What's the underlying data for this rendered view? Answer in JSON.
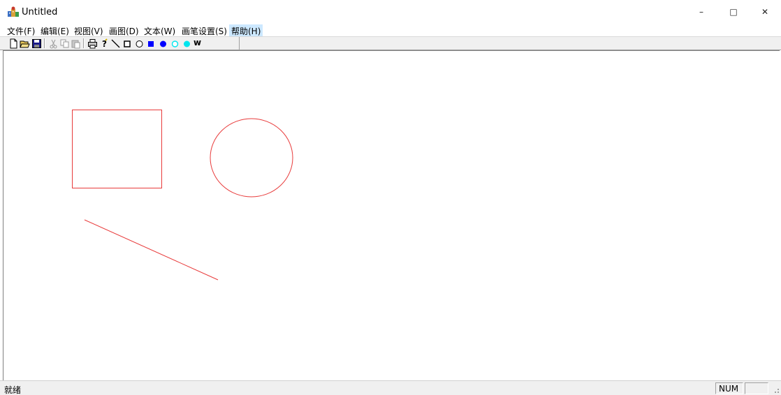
{
  "window": {
    "title": "Untitled",
    "controls": {
      "minimize": "–",
      "maximize": "□",
      "close": "✕"
    }
  },
  "menubar": {
    "items": [
      {
        "label": "文件(F)"
      },
      {
        "label": "编辑(E)"
      },
      {
        "label": "视图(V)"
      },
      {
        "label": "画图(D)"
      },
      {
        "label": "文本(W)"
      },
      {
        "label": "画笔设置(S)"
      },
      {
        "label": "帮助(H)"
      }
    ]
  },
  "toolbar": {
    "buttons": [
      {
        "icon": "new-document-icon"
      },
      {
        "icon": "open-folder-icon"
      },
      {
        "icon": "save-icon"
      },
      {
        "icon": "cut-icon"
      },
      {
        "icon": "copy-icon"
      },
      {
        "icon": "paste-icon"
      },
      {
        "icon": "print-icon"
      },
      {
        "icon": "help-icon"
      },
      {
        "icon": "line-tool-icon"
      },
      {
        "icon": "rectangle-tool-icon"
      },
      {
        "icon": "ellipse-tool-icon"
      },
      {
        "icon": "filled-rectangle-tool-icon"
      },
      {
        "icon": "filled-ellipse-tool-icon"
      },
      {
        "icon": "cyan-rectangle-tool-icon"
      },
      {
        "icon": "cyan-ellipse-tool-icon"
      },
      {
        "icon": "text-tool-icon",
        "label": "w"
      }
    ]
  },
  "drawing": {
    "stroke_color": "#e83a3a",
    "shapes": [
      "rectangle",
      "ellipse",
      "line"
    ]
  },
  "statusbar": {
    "text": "就绪",
    "num": "NUM"
  },
  "colors": {
    "blue_tool": "#0000ff",
    "cyan_tool": "#00e5ee",
    "menu_highlight": "#cce8ff"
  }
}
